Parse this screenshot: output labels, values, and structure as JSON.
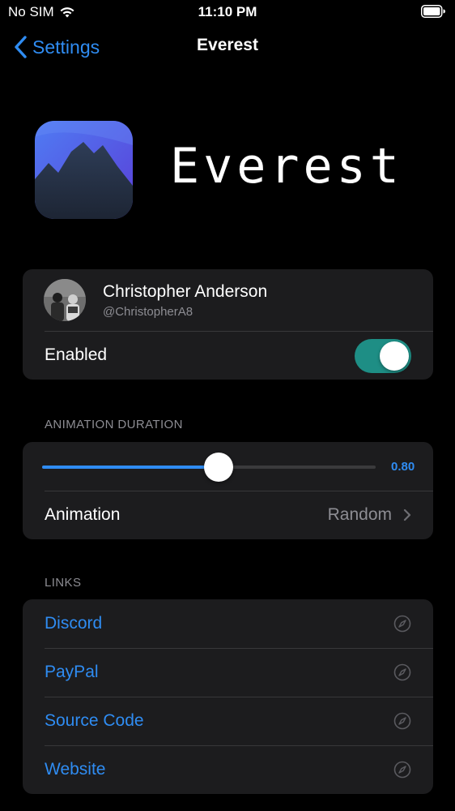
{
  "status_bar": {
    "carrier": "No SIM",
    "time": "11:10 PM",
    "icons": [
      "wifi-icon",
      "battery-icon"
    ]
  },
  "nav": {
    "back_label": "Settings",
    "title": "Everest",
    "icons": [
      "back-chevron-icon"
    ]
  },
  "header": {
    "app_name": "Everest",
    "icon": "mountain-app-icon"
  },
  "profile": {
    "name": "Christopher Anderson",
    "handle": "@ChristopherA8",
    "icon": "avatar"
  },
  "enabled": {
    "label": "Enabled",
    "on": true
  },
  "animation_duration": {
    "header": "ANIMATION DURATION",
    "value_text": "0.80",
    "fraction": 0.53
  },
  "animation": {
    "label": "Animation",
    "value": "Random",
    "icon": "chevron-right-icon"
  },
  "links": {
    "header": "LINKS",
    "items": [
      {
        "label": "Discord",
        "icon": "compass-icon"
      },
      {
        "label": "PayPal",
        "icon": "compass-icon"
      },
      {
        "label": "Source Code",
        "icon": "compass-icon"
      },
      {
        "label": "Website",
        "icon": "compass-icon"
      }
    ]
  },
  "colors": {
    "background": "#000000",
    "card": "#1c1c1e",
    "accent": "#2f8cf2",
    "toggle_on": "#1e8e85",
    "secondary_text": "#8d8d93"
  }
}
